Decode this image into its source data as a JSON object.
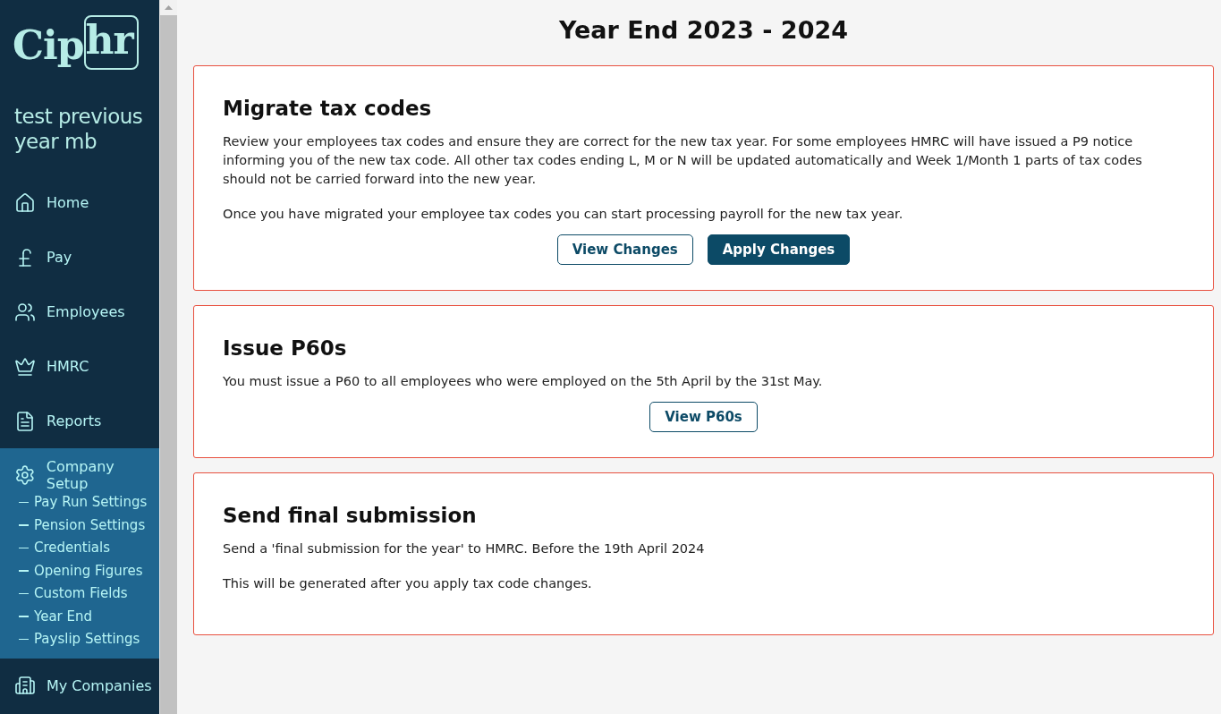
{
  "sidebar": {
    "logo": {
      "text": "Cip",
      "boxed_text": "hr"
    },
    "company": "test previous year mb",
    "items": [
      {
        "label": "Home",
        "expanded": false
      },
      {
        "label": "Pay",
        "expanded": false
      },
      {
        "label": "Employees",
        "expanded": false
      },
      {
        "label": "HMRC",
        "expanded": false
      },
      {
        "label": "Reports",
        "expanded": false
      },
      {
        "label": "Company Setup",
        "expanded": true,
        "children": [
          {
            "label": "Pay Run Settings"
          },
          {
            "label": "Pension Settings"
          },
          {
            "label": "Credentials"
          },
          {
            "label": "Opening Figures"
          },
          {
            "label": "Custom Fields"
          },
          {
            "label": "Year End"
          },
          {
            "label": "Payslip Settings"
          }
        ]
      },
      {
        "label": "My Companies",
        "expanded": false
      }
    ]
  },
  "page": {
    "title": "Year End 2023 - 2024",
    "cards": [
      {
        "title": "Migrate tax codes",
        "paragraphs": [
          "Review your employees tax codes and ensure they are correct for the new tax year. For some employees HMRC will have issued a P9 notice informing you of the new tax code. All other tax codes ending L, M or N will be updated automatically and Week 1/Month 1 parts of tax codes should not be carried forward into the new year.",
          "Once you have migrated your employee tax codes you can start processing payroll for the new tax year."
        ],
        "buttons": [
          {
            "label": "View Changes",
            "kind": "outline"
          },
          {
            "label": "Apply Changes",
            "kind": "filled"
          }
        ]
      },
      {
        "title": "Issue P60s",
        "paragraphs": [
          "You must issue a P60 to all employees who were employed on the 5th April by the 31st May."
        ],
        "buttons": [
          {
            "label": "View P60s",
            "kind": "outline"
          }
        ]
      },
      {
        "title": "Send final submission",
        "paragraphs": [
          "Send a 'final submission for the year' to HMRC. Before the 19th April 2024",
          "This will be generated after you apply tax code changes."
        ]
      }
    ]
  }
}
